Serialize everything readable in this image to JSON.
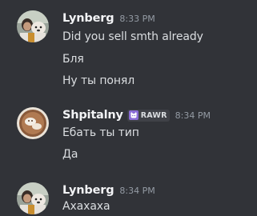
{
  "messages": [
    {
      "username": "Lynberg",
      "timestamp": "8:33 PM",
      "lines": [
        "Did you sell smth already",
        "Бля",
        "Ну ты понял"
      ]
    },
    {
      "username": "Shpitalny",
      "tag": "RAWR",
      "tag_icon": "cat-face-icon",
      "timestamp": "8:34 PM",
      "lines": [
        "Ебать ты тип",
        "Да"
      ]
    },
    {
      "username": "Lynberg",
      "timestamp": "8:34 PM",
      "lines": [
        "Ахахаха"
      ]
    }
  ],
  "colors": {
    "background": "#313338",
    "username": "#f2f3f5",
    "message_text": "#dbdee1",
    "timestamp": "#949ba4",
    "tag_background": "#3f4147",
    "tag_icon": "#8b6cd6"
  }
}
